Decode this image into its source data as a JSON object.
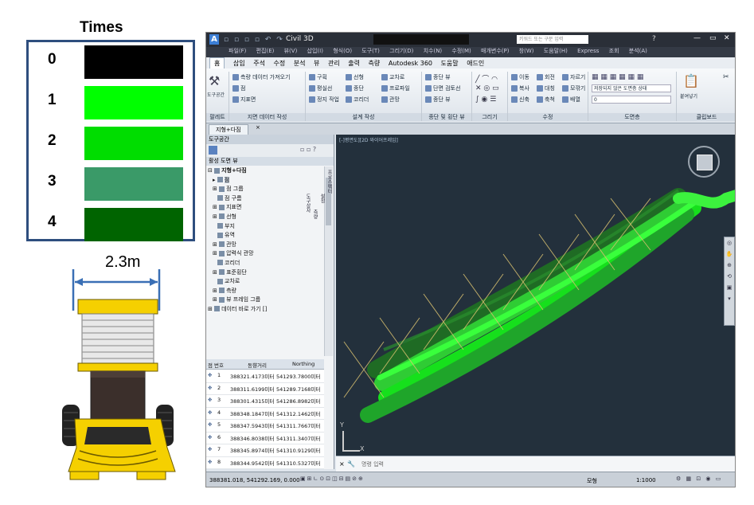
{
  "legend": {
    "title": "Times",
    "items": [
      {
        "label": "0",
        "color": "#000000"
      },
      {
        "label": "1",
        "color": "#00ff00"
      },
      {
        "label": "2",
        "color": "#00dd00"
      },
      {
        "label": "3",
        "color": "#3a9a68"
      },
      {
        "label": "4",
        "color": "#006400"
      }
    ]
  },
  "machine": {
    "width_label": "2.3m",
    "color": "#f5d000"
  },
  "app": {
    "title": "Civil 3D",
    "search_placeholder": "키워드 또는 구문 입력",
    "menu": [
      "파일(F)",
      "편집(E)",
      "뷰(V)",
      "삽입(I)",
      "형식(O)",
      "도구(T)",
      "그리기(D)",
      "치수(N)",
      "수정(M)",
      "매개변수(P)",
      "창(W)",
      "도움말(H)",
      "Express",
      "조회",
      "분석(A)"
    ],
    "tabs": [
      "홈",
      "삽입",
      "주석",
      "수정",
      "분석",
      "뷰",
      "관리",
      "출력",
      "측량",
      "Autodesk 360",
      "도움말",
      "애드인"
    ],
    "ribbon_panels": [
      {
        "label": "팔레트",
        "items": [
          "도구공간"
        ]
      },
      {
        "label": "지면 데이터 작성",
        "items": [
          "측량 데이터 가져오기",
          "점",
          "지표면"
        ]
      },
      {
        "label": "설계 작성",
        "items": [
          "구획",
          "선형",
          "교차로",
          "평실선",
          "종단",
          "프로파일",
          "정지 작업",
          "코리더",
          "관망"
        ]
      },
      {
        "label": "종단 및 횡단 뷰",
        "items": [
          "종단 뷰",
          "단면 검토선",
          "종단 뷰"
        ]
      },
      {
        "label": "그리기",
        "items": []
      },
      {
        "label": "수정",
        "items": [
          "이동",
          "회전",
          "자르기",
          "복사",
          "대칭",
          "모깎기",
          "신축",
          "축척",
          "배열"
        ]
      },
      {
        "label": "도면층",
        "items": [
          "저장되지 않은 도면층 상태",
          "0"
        ]
      },
      {
        "label": "클립보드",
        "items": [
          "붙여넣기"
        ]
      }
    ],
    "doc_tab": "지형+다짐",
    "toolspace": {
      "title": "도구공간",
      "view_label": "활성 도면 뷰",
      "tree": [
        "지형+다짐",
        "점",
        "점 그룹",
        "점 구름",
        "지표면",
        "선형",
        "부지",
        "유역",
        "관망",
        "압력식 관망",
        "코리더",
        "표준횡단",
        "교차로",
        "측량",
        "뷰 프레임 그룹",
        "데이터 바로 가기 []"
      ],
      "side_tabs": [
        "프로스펙터",
        "설정",
        "측량",
        "도구상자"
      ]
    },
    "grid": {
      "headers": [
        "점 번호",
        "동향거리",
        "Northing"
      ],
      "rows": [
        [
          "1",
          "388321.4173미터",
          "541293.7800미터"
        ],
        [
          "2",
          "388311.6199미터",
          "541289.7168미터"
        ],
        [
          "3",
          "388301.4315미터",
          "541286.8982미터"
        ],
        [
          "4",
          "388348.1847미터",
          "541312.1462미터"
        ],
        [
          "5",
          "388347.5943미터",
          "541311.7667미터"
        ],
        [
          "6",
          "388346.8038미터",
          "541311.3407미터"
        ],
        [
          "7",
          "388345.8974미터",
          "541310.9129미터"
        ],
        [
          "8",
          "388344.9542미터",
          "541310.5327미터"
        ]
      ]
    },
    "viewport_label": "[-]평면도][2D 와이어프레임]",
    "command_placeholder": "명령 입력",
    "status_coords": "388381.018, 541292.169, 0.000",
    "status_model": "모형",
    "status_scale": "1:1000"
  }
}
